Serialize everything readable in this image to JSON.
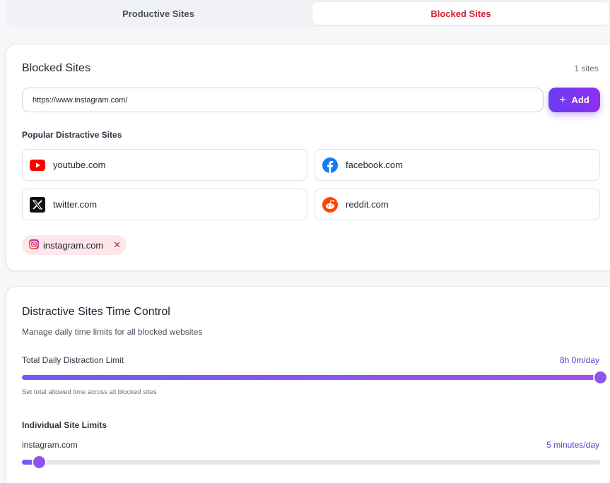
{
  "tabs": {
    "productive": "Productive Sites",
    "blocked": "Blocked Sites"
  },
  "blocked_card": {
    "title": "Blocked Sites",
    "count": "1 sites",
    "input_value": "https://www.instagram.com/",
    "add_label": "Add",
    "popular_label": "Popular Distractive Sites",
    "popular_sites": [
      {
        "name": "youtube.com",
        "icon": "youtube-icon"
      },
      {
        "name": "facebook.com",
        "icon": "facebook-icon"
      },
      {
        "name": "twitter.com",
        "icon": "x-twitter-icon"
      },
      {
        "name": "reddit.com",
        "icon": "reddit-icon"
      }
    ],
    "blocked_list": [
      {
        "name": "instagram.com",
        "icon": "instagram-icon",
        "remove": "✕"
      }
    ]
  },
  "time_card": {
    "title": "Distractive Sites Time Control",
    "description": "Manage daily time limits for all blocked websites",
    "total_label": "Total Daily Distraction Limit",
    "total_value": "8h 0m/day",
    "total_fraction": 1.0,
    "total_hint": "Set total allowed time across all blocked sites",
    "individual_label": "Individual Site Limits",
    "sites": [
      {
        "name": "instagram.com",
        "value": "5 minutes/day",
        "fraction": 0.03
      }
    ]
  },
  "colors": {
    "accent": "#7b3cf0",
    "blocked_tab": "#d21f2c",
    "value_text": "#5b3fd6",
    "chip_bg": "#fde7ea"
  }
}
